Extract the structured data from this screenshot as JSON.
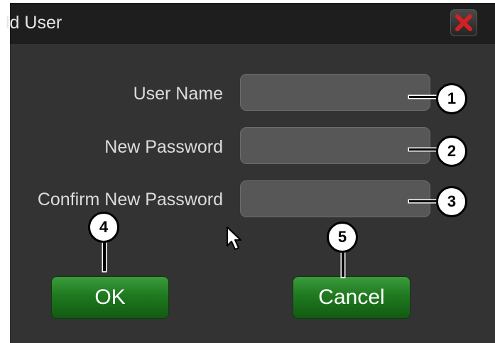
{
  "window": {
    "title": "ld User",
    "close_icon": "close-x-icon"
  },
  "form": {
    "fields": [
      {
        "label": "User Name",
        "value": ""
      },
      {
        "label": "New Password",
        "value": ""
      },
      {
        "label": "Confirm New Password",
        "value": ""
      }
    ]
  },
  "buttons": {
    "ok_label": "OK",
    "cancel_label": "Cancel"
  },
  "callouts": [
    "1",
    "2",
    "3",
    "4",
    "5"
  ],
  "colors": {
    "background": "#333333",
    "titlebar": "#1e1e1e",
    "button_green": "#1f7a1f",
    "close_red": "#d42020"
  }
}
